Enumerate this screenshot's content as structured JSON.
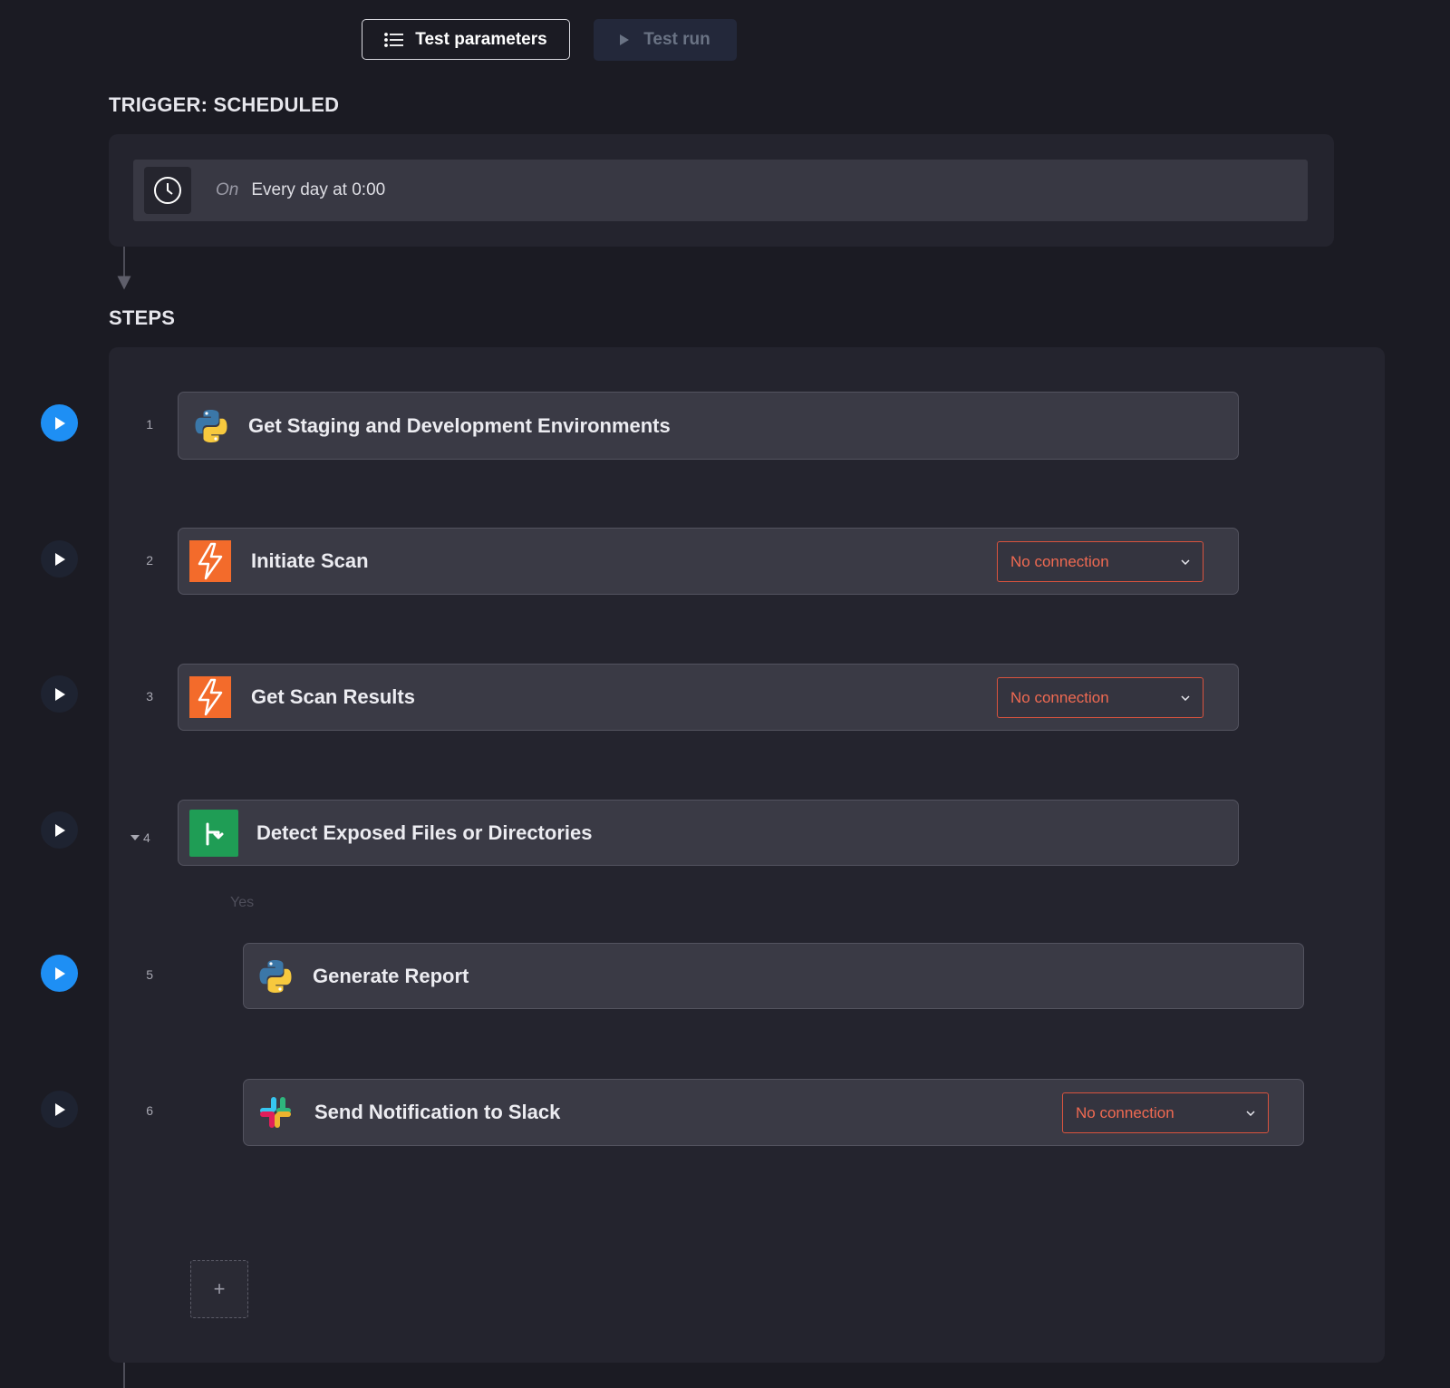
{
  "toolbar": {
    "test_parameters_label": "Test parameters",
    "test_run_label": "Test run"
  },
  "trigger": {
    "section_title": "TRIGGER: SCHEDULED",
    "on_label": "On",
    "schedule_text": "Every day at 0:00"
  },
  "steps": {
    "section_title": "STEPS",
    "branch_label": "Yes",
    "add_label": "+",
    "items": [
      {
        "number": "1",
        "title": "Get Staging and Development Environments",
        "icon": "python-icon",
        "run_state": "active"
      },
      {
        "number": "2",
        "title": "Initiate Scan",
        "icon": "scanner-bolt-icon",
        "connection": "No connection",
        "run_state": "idle"
      },
      {
        "number": "3",
        "title": "Get Scan Results",
        "icon": "scanner-bolt-icon",
        "connection": "No connection",
        "run_state": "idle"
      },
      {
        "number": "4",
        "title": "Detect Exposed Files or Directories",
        "icon": "branch-condition-icon",
        "run_state": "idle",
        "collapsible": true
      },
      {
        "number": "5",
        "title": "Generate Report",
        "icon": "python-icon",
        "run_state": "active"
      },
      {
        "number": "6",
        "title": "Send Notification to Slack",
        "icon": "slack-icon",
        "connection": "No connection",
        "run_state": "idle"
      }
    ]
  },
  "colors": {
    "background": "#1b1b23",
    "panel": "#24242e",
    "card": "#3a3a45",
    "accent_blue": "#1e8ff4",
    "error_red": "#f06a52",
    "condition_green": "#1f9d55",
    "scanner_orange": "#f36b2b"
  }
}
